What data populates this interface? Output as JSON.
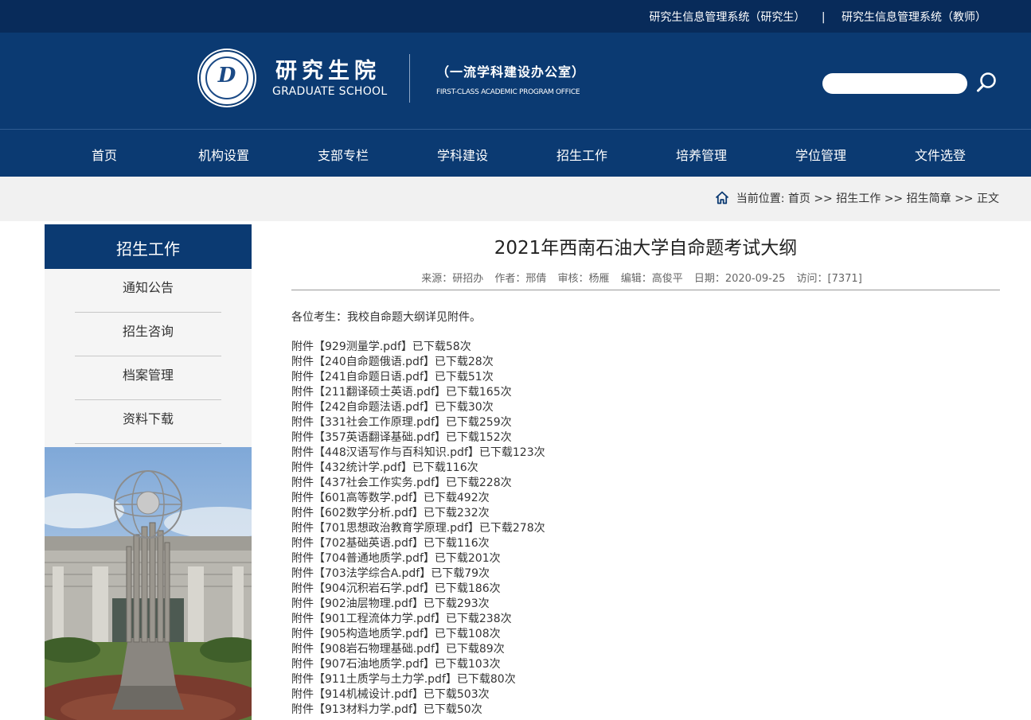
{
  "topbar": {
    "link_student": "研究生信息管理系统（研究生）",
    "separator": "|",
    "link_teacher": "研究生信息管理系统（教师）"
  },
  "header": {
    "logo_glyph": "D",
    "brand_cn": "研究生院",
    "brand_en": "GRADUATE SCHOOL",
    "office_cn": "（一流学科建设办公室）",
    "office_en": "FIRST-CLASS ACADEMIC PROGRAM OFFICE",
    "search_placeholder": "",
    "search_icon": "search-icon"
  },
  "nav": {
    "items": [
      "首页",
      "机构设置",
      "支部专栏",
      "学科建设",
      "招生工作",
      "培养管理",
      "学位管理",
      "文件选登"
    ]
  },
  "breadcrumb": {
    "prefix": "当前位置:",
    "items": [
      "首页",
      "招生工作",
      "招生简章",
      "正文"
    ],
    "separator": ">>"
  },
  "sidebar": {
    "title": "招生工作",
    "items": [
      "通知公告",
      "招生咨询",
      "档案管理",
      "资料下载"
    ]
  },
  "article": {
    "title": "2021年西南石油大学自命题考试大纲",
    "meta": {
      "source": "来源：研招办",
      "author": "作者：邢倩",
      "reviewer": "审核：杨雁",
      "editor": "编辑：高俊平",
      "date": "日期：2020-09-25",
      "visits": "访问：[7371]"
    },
    "intro": "各位考生：我校自命题大纲详见附件。",
    "attachments": [
      {
        "file": "附件【929测量学.pdf】",
        "count": "已下载58次"
      },
      {
        "file": "附件【240自命题俄语.pdf】",
        "count": "已下载28次"
      },
      {
        "file": "附件【241自命题日语.pdf】",
        "count": "已下载51次"
      },
      {
        "file": "附件【211翻译硕士英语.pdf】",
        "count": "已下载165次"
      },
      {
        "file": "附件【242自命题法语.pdf】",
        "count": "已下载30次"
      },
      {
        "file": "附件【331社会工作原理.pdf】",
        "count": "已下载259次"
      },
      {
        "file": "附件【357英语翻译基础.pdf】",
        "count": "已下载152次"
      },
      {
        "file": "附件【448汉语写作与百科知识.pdf】",
        "count": "已下载123次"
      },
      {
        "file": "附件【432统计学.pdf】",
        "count": "已下载116次"
      },
      {
        "file": "附件【437社会工作实务.pdf】",
        "count": "已下载228次"
      },
      {
        "file": "附件【601高等数学.pdf】",
        "count": "已下载492次"
      },
      {
        "file": "附件【602数学分析.pdf】",
        "count": "已下载232次"
      },
      {
        "file": "附件【701思想政治教育学原理.pdf】",
        "count": "已下载278次"
      },
      {
        "file": "附件【702基础英语.pdf】",
        "count": "已下载116次"
      },
      {
        "file": "附件【704普通地质学.pdf】",
        "count": "已下载201次"
      },
      {
        "file": "附件【703法学综合A.pdf】",
        "count": "已下载79次"
      },
      {
        "file": "附件【904沉积岩石学.pdf】",
        "count": "已下载186次"
      },
      {
        "file": "附件【902油层物理.pdf】",
        "count": "已下载293次"
      },
      {
        "file": "附件【901工程流体力学.pdf】",
        "count": "已下载238次"
      },
      {
        "file": "附件【905构造地质学.pdf】",
        "count": "已下载108次"
      },
      {
        "file": "附件【908岩石物理基础.pdf】",
        "count": "已下载89次"
      },
      {
        "file": "附件【907石油地质学.pdf】",
        "count": "已下载103次"
      },
      {
        "file": "附件【911土质学与土力学.pdf】",
        "count": "已下载80次"
      },
      {
        "file": "附件【914机械设计.pdf】",
        "count": "已下载503次"
      },
      {
        "file": "附件【913材料力学.pdf】",
        "count": "已下载50次"
      }
    ]
  },
  "colors": {
    "topbar": "#082b5a",
    "primary": "#0b3a72",
    "breadcrumb_band": "#f1f1f1",
    "sidebar_bg": "#f5f5f5"
  }
}
